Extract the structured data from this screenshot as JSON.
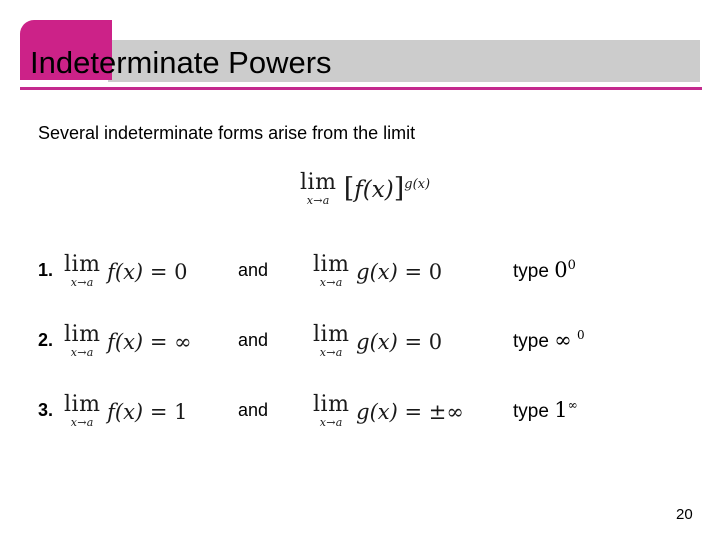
{
  "slide": {
    "title": "Indeterminate Powers",
    "intro": "Several indeterminate forms arise from the limit",
    "page_number": "20",
    "accent_color": "#cc2288",
    "title_bar_color": "#cccccc",
    "underline_color": "#c42a8e",
    "background_color": "#ffffff"
  },
  "formula": {
    "limit_operator": "lim",
    "limit_subscript": "x→a",
    "open_bracket": "[",
    "base_function": "f(x)",
    "close_bracket": "]",
    "exponent": "g(x)"
  },
  "rows": [
    {
      "number": "1.",
      "left": {
        "limit_operator": "lim",
        "limit_subscript": "x→a",
        "function": "f(x)",
        "relation": "=",
        "value": "0"
      },
      "conjunction": "and",
      "right": {
        "limit_operator": "lim",
        "limit_subscript": "x→a",
        "function": "g(x)",
        "relation": "=",
        "value": "0"
      },
      "type": {
        "label": "type",
        "base": "0",
        "exponent": "0"
      }
    },
    {
      "number": "2.",
      "left": {
        "limit_operator": "lim",
        "limit_subscript": "x→a",
        "function": "f(x)",
        "relation": "=",
        "value": "∞"
      },
      "conjunction": "and",
      "right": {
        "limit_operator": "lim",
        "limit_subscript": "x→a",
        "function": "g(x)",
        "relation": "=",
        "value": "0"
      },
      "type": {
        "label": "type",
        "base": "∞",
        "exponent": "0"
      }
    },
    {
      "number": "3.",
      "left": {
        "limit_operator": "lim",
        "limit_subscript": "x→a",
        "function": "f(x)",
        "relation": "=",
        "value": "1"
      },
      "conjunction": "and",
      "right": {
        "limit_operator": "lim",
        "limit_subscript": "x→a",
        "function": "g(x)",
        "relation": "=",
        "value": "±∞"
      },
      "type": {
        "label": "type",
        "base": "1",
        "exponent": "∞"
      }
    }
  ]
}
